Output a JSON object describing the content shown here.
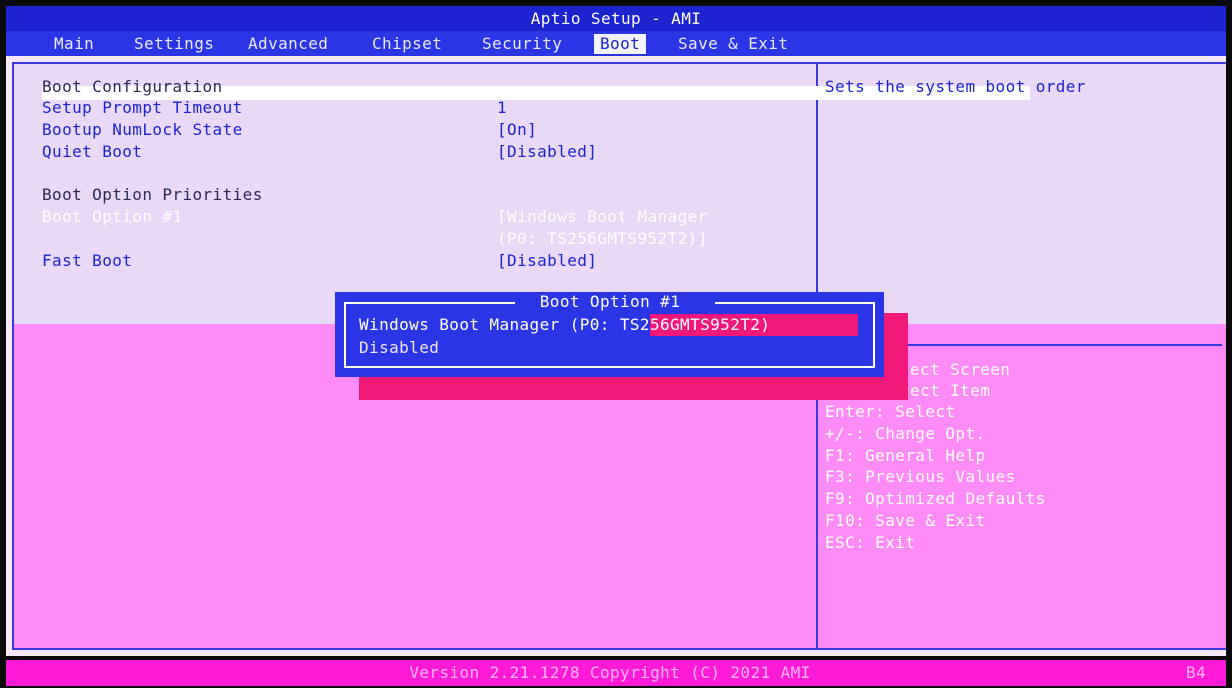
{
  "header": {
    "title": "Aptio Setup - AMI",
    "tabs": [
      "Main",
      "Settings",
      "Advanced",
      "Chipset",
      "Security",
      "Boot",
      "Save & Exit"
    ],
    "active_tab": "Boot"
  },
  "boot": {
    "section_title": "Boot Configuration",
    "items": [
      {
        "label": "Setup Prompt Timeout",
        "value": "1"
      },
      {
        "label": "Bootup NumLock State",
        "value": "[On]"
      },
      {
        "label": "Quiet Boot",
        "value": "[Disabled]"
      }
    ],
    "priorities_title": "Boot Option Priorities",
    "option1": {
      "label": "Boot Option #1",
      "value_line1": "[Windows Boot Manager",
      "value_line2": "(P0: TS256GMTS952T2)]"
    },
    "fast_boot": {
      "label": "Fast Boot",
      "value": "[Disabled]"
    }
  },
  "help": {
    "description": "Sets the system boot order",
    "keys": [
      "ect Screen",
      "ect Item",
      "Enter: Select",
      "+/-: Change Opt.",
      "F1: General Help",
      "F3: Previous Values",
      "F9: Optimized Defaults",
      "F10: Save & Exit",
      "ESC: Exit"
    ]
  },
  "popup": {
    "title": "Boot Option #1",
    "options": [
      "Windows Boot Manager (P0: TS256GMTS952T2)",
      "Disabled"
    ],
    "selected_index": 0
  },
  "footer": {
    "version": "Version 2.21.1278 Copyright (C) 2021 AMI",
    "code": "B4"
  },
  "colors": {
    "header_blue": "#1c24d0",
    "tab_blue": "#2a36e6",
    "panel_lavender": "#ead8f7",
    "panel_pink": "#ff8cf6",
    "popup_shadow": "#f0197a",
    "footer_magenta": "#ff1ad8"
  }
}
